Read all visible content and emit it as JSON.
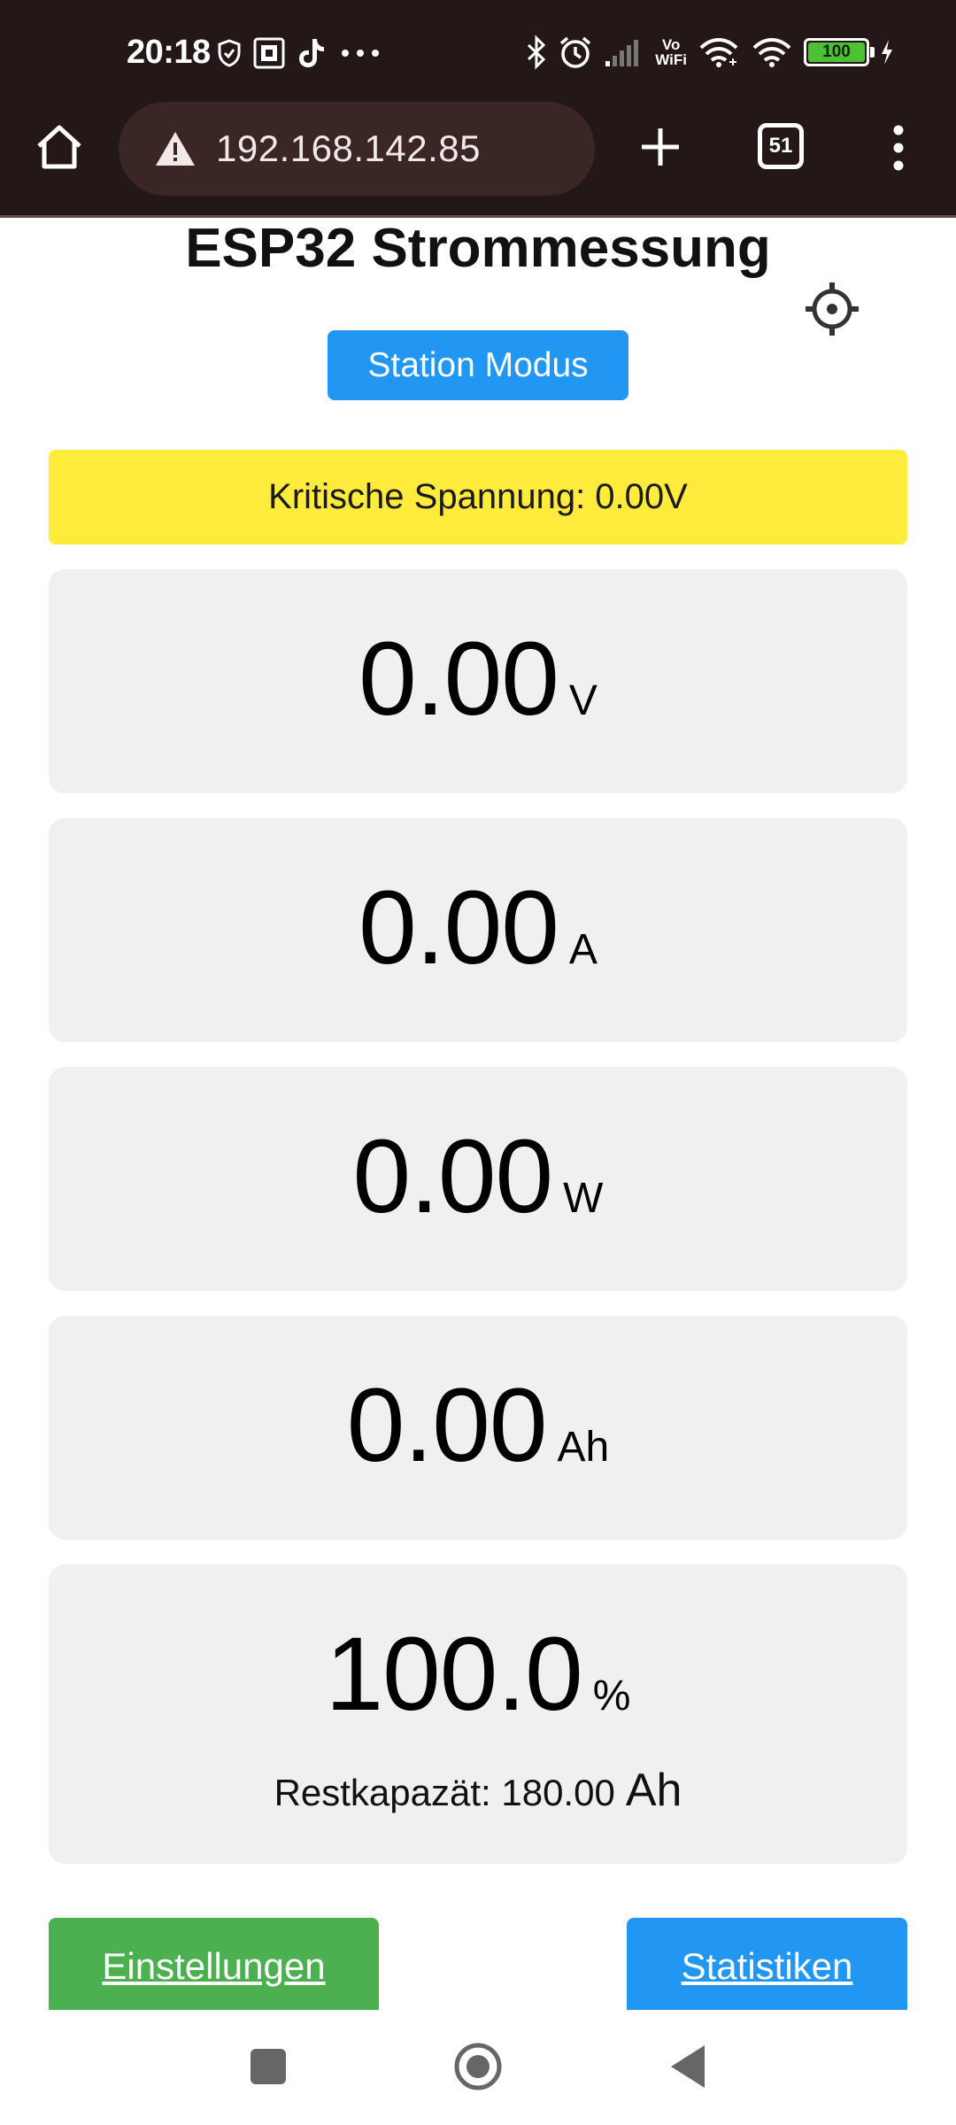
{
  "status_bar": {
    "time": "20:18",
    "left_icons": [
      "shield-check-icon",
      "scan-icon",
      "tiktok-icon",
      "more-dots-icon"
    ],
    "right_icons": [
      "bluetooth-icon",
      "alarm-icon",
      "signal-icon",
      "vowifi-icon",
      "wifi-icon",
      "wifi-icon",
      "battery-icon",
      "charging-icon"
    ],
    "vowifi_line1": "Vo",
    "vowifi_line2": "WiFi",
    "battery_level": "100"
  },
  "browser": {
    "url": "192.168.142.85",
    "tab_count": "51",
    "icons": [
      "home-icon",
      "warning-icon",
      "plus-icon",
      "tabs-icon",
      "overflow-menu-icon"
    ]
  },
  "page": {
    "title": "ESP32 Strommessung",
    "mode_button": "Station Modus",
    "warning": "Kritische Spannung: 0.00V",
    "cards": [
      {
        "value": "0.00",
        "unit": "V"
      },
      {
        "value": "0.00",
        "unit": "A"
      },
      {
        "value": "0.00",
        "unit": "W"
      },
      {
        "value": "0.00",
        "unit": "Ah"
      },
      {
        "value": "100.0",
        "unit": "%",
        "sub_label": "Restkapazät: 180.00",
        "sub_unit": "Ah"
      }
    ],
    "settings_button": "Einstellungen",
    "stats_button": "Statistiken"
  },
  "colors": {
    "chrome_bg": "#231717",
    "accent_blue": "#2196f3",
    "accent_green": "#4caf50",
    "warning_yellow": "#ffeb3b",
    "card_bg": "#f0f0f0"
  },
  "nav_bar": {
    "icons": [
      "recents-square-icon",
      "home-circle-icon",
      "back-triangle-icon"
    ]
  }
}
